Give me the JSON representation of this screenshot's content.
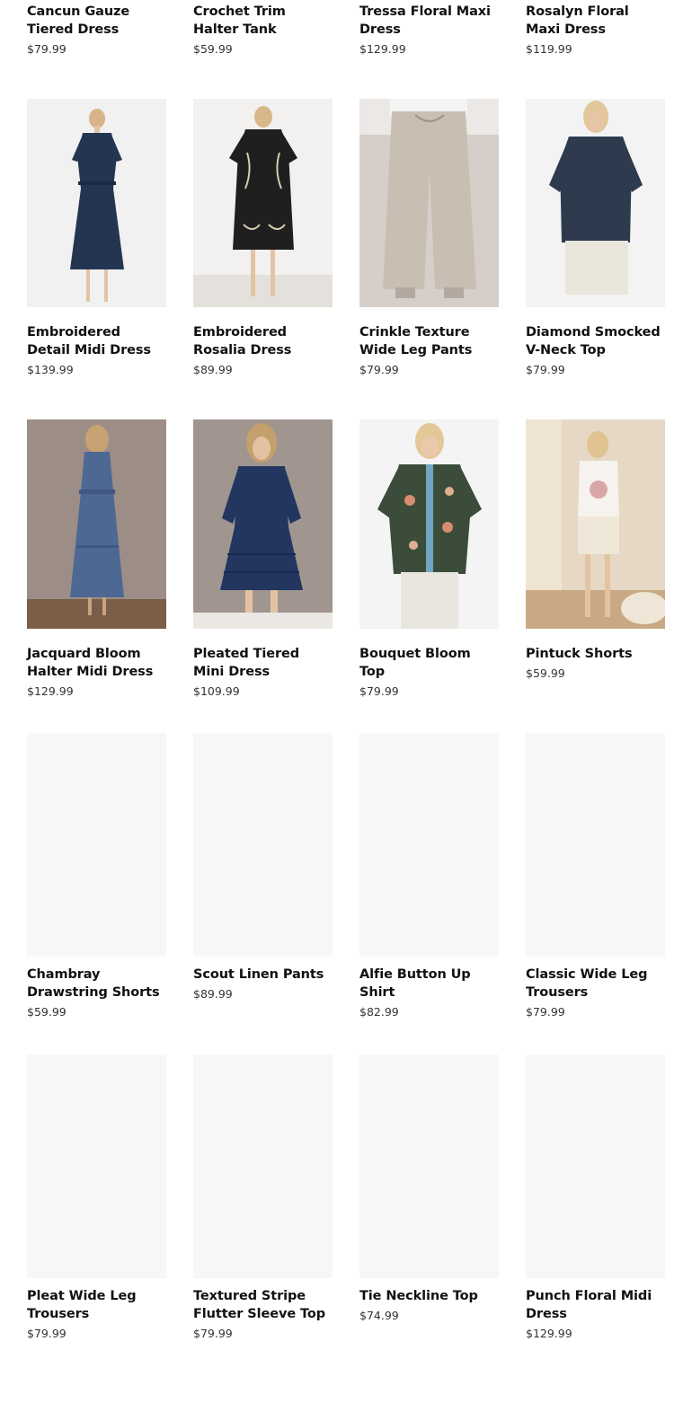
{
  "products": [
    {
      "title": "Cancun Gauze Tiered Dress",
      "price": "$79.99"
    },
    {
      "title": "Crochet Trim Halter Tank",
      "price": "$59.99"
    },
    {
      "title": "Tressa Floral Maxi Dress",
      "price": "$129.99"
    },
    {
      "title": "Rosalyn Floral Maxi Dress",
      "price": "$119.99"
    },
    {
      "title": "Embroidered Detail Midi Dress",
      "price": "$139.99",
      "image": "navy-midi-dress-photo"
    },
    {
      "title": "Embroidered Rosalia Dress",
      "price": "$89.99",
      "image": "black-embroidered-dress-photo"
    },
    {
      "title": "Crinkle Texture Wide Leg Pants",
      "price": "$79.99",
      "image": "beige-wide-leg-pants-photo"
    },
    {
      "title": "Diamond Smocked V-Neck Top",
      "price": "$79.99",
      "image": "navy-smocked-top-photo"
    },
    {
      "title": "Jacquard Bloom Halter Midi Dress",
      "price": "$129.99",
      "image": "blue-halter-midi-dress-photo"
    },
    {
      "title": "Pleated Tiered Mini Dress",
      "price": "$109.99",
      "image": "navy-pleated-mini-dress-photo"
    },
    {
      "title": "Bouquet Bloom Top",
      "price": "$79.99",
      "image": "green-floral-top-photo"
    },
    {
      "title": "Pintuck Shorts",
      "price": "$59.99",
      "image": "cream-shorts-photo"
    },
    {
      "title": "Chambray Drawstring Shorts",
      "price": "$59.99",
      "image": "placeholder"
    },
    {
      "title": "Scout Linen Pants",
      "price": "$89.99",
      "image": "placeholder"
    },
    {
      "title": "Alfie Button Up Shirt",
      "price": "$82.99",
      "image": "placeholder"
    },
    {
      "title": "Classic Wide Leg Trousers",
      "price": "$79.99",
      "image": "placeholder"
    },
    {
      "title": "Pleat Wide Leg Trousers",
      "price": "$79.99",
      "image": "placeholder"
    },
    {
      "title": "Textured Stripe Flutter Sleeve Top",
      "price": "$79.99",
      "image": "placeholder"
    },
    {
      "title": "Tie Neckline Top",
      "price": "$74.99",
      "image": "placeholder"
    },
    {
      "title": "Punch Floral Midi Dress",
      "price": "$129.99",
      "image": "placeholder"
    }
  ],
  "colors": {
    "placeholder_bg": "#f7f7f7",
    "title": "#111111",
    "price": "#333333"
  }
}
